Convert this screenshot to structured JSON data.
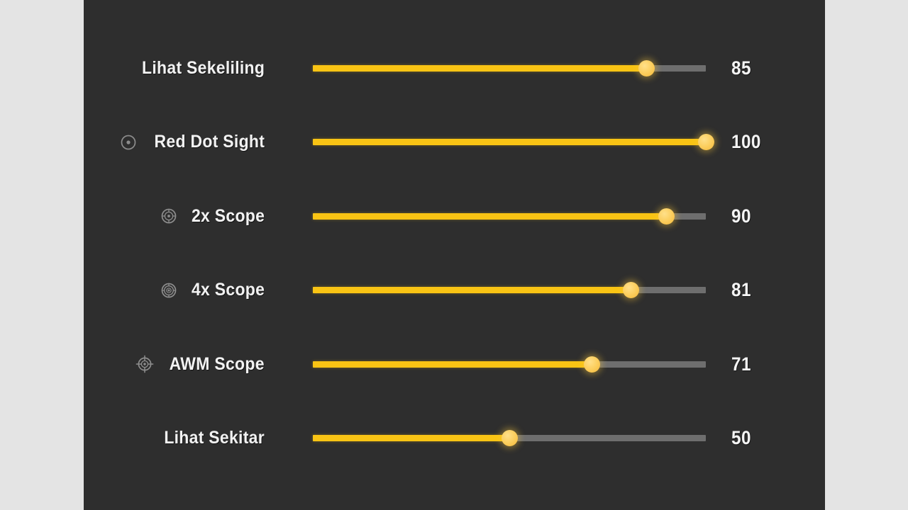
{
  "panel": {
    "background_color": "#2e2e2e",
    "page_background_color": "#e4e4e4",
    "accent_color": "#f9c414",
    "thumb_color": "#fcd062",
    "track_color": "#6e6e6e",
    "text_color": "#f2f2f2"
  },
  "settings": [
    {
      "label": "Lihat Sekeliling",
      "icon": "none",
      "value": "85",
      "percent": 85
    },
    {
      "label": "Red Dot Sight",
      "icon": "red-dot-sight-icon",
      "value": "100",
      "percent": 100
    },
    {
      "label": "2x Scope",
      "icon": "2x-scope-icon",
      "value": "90",
      "percent": 90
    },
    {
      "label": "4x Scope",
      "icon": "4x-scope-icon",
      "value": "81",
      "percent": 81
    },
    {
      "label": "AWM Scope",
      "icon": "awm-scope-icon",
      "value": "71",
      "percent": 71
    },
    {
      "label": "Lihat Sekitar",
      "icon": "none",
      "value": "50",
      "percent": 50
    }
  ]
}
